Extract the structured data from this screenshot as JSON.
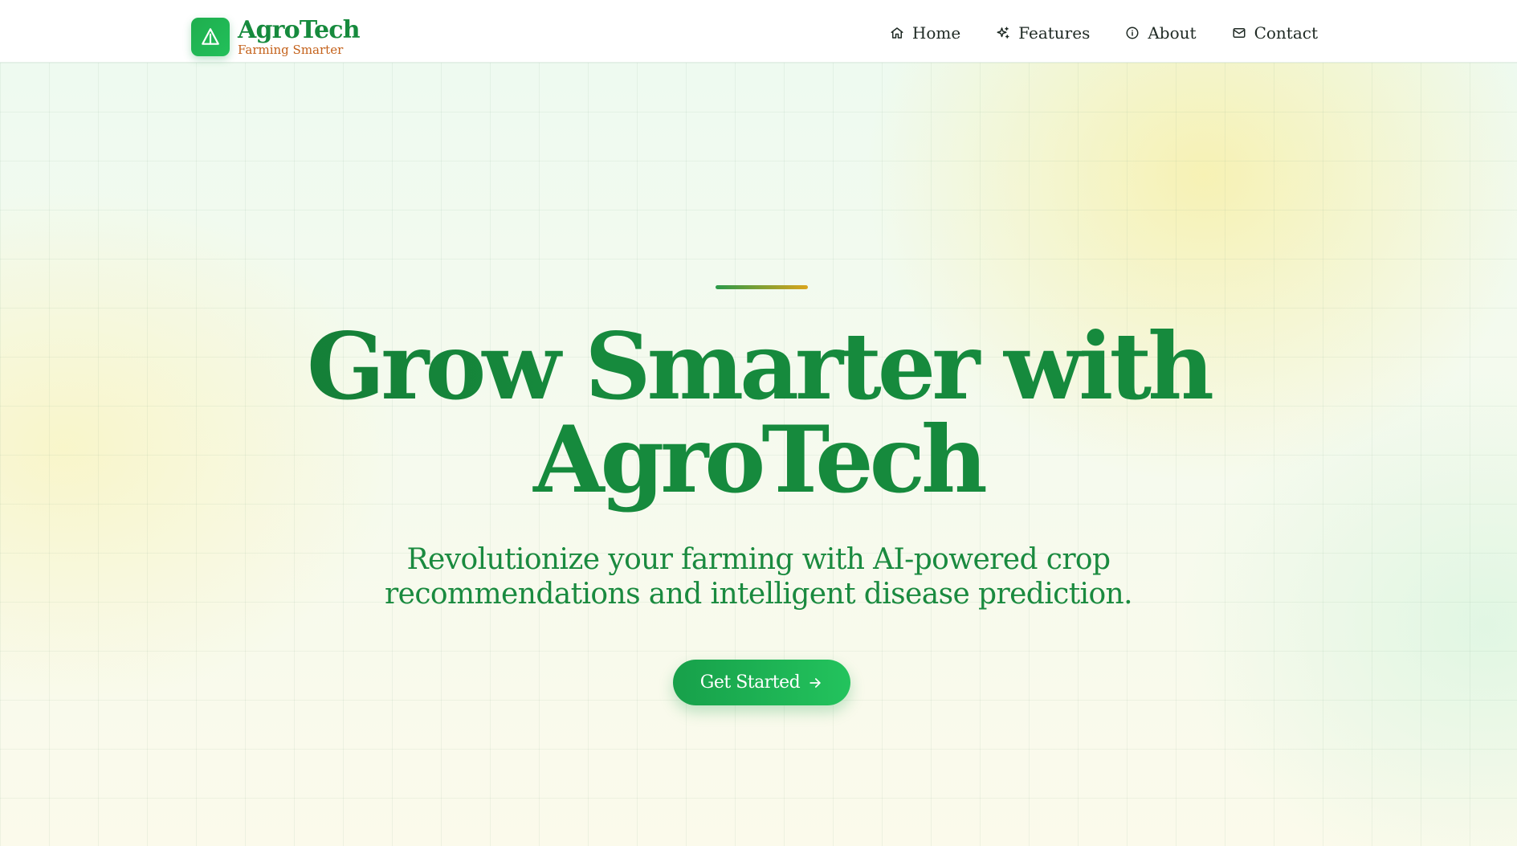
{
  "brand": {
    "name": "AgroTech",
    "tagline": "Farming Smarter",
    "logo_icon": "sprout-triangle-icon"
  },
  "nav": {
    "items": [
      {
        "label": "Home",
        "icon": "home-icon"
      },
      {
        "label": "Features",
        "icon": "sparkles-icon"
      },
      {
        "label": "About",
        "icon": "info-icon"
      },
      {
        "label": "Contact",
        "icon": "mail-icon"
      }
    ]
  },
  "hero": {
    "headline_line1": "Grow Smarter with",
    "headline_line2": "AgroTech",
    "subtitle_line1": "Revolutionize your farming with AI-powered crop",
    "subtitle_line2": "recommendations and intelligent disease prediction.",
    "cta_label": "Get Started",
    "cta_icon": "arrow-right-icon"
  },
  "colors": {
    "brand_green": "#168a3d",
    "tagline_orange": "#c4611a",
    "cta_start": "#17a04a",
    "cta_end": "#23c35d",
    "accent_start": "#2a9a4a",
    "accent_end": "#dba51c"
  }
}
